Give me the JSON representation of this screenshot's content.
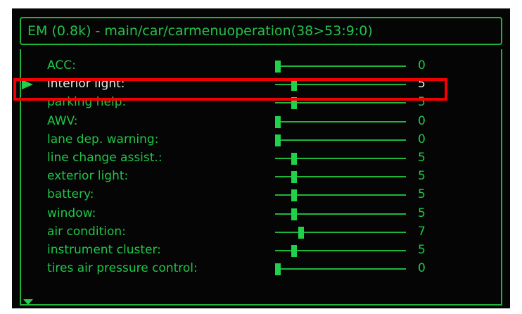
{
  "header": {
    "title": "EM (0.8k) - main/car/carmenuoperation(38>53:9:0)"
  },
  "menu": {
    "items": [
      {
        "label": "ACC:",
        "value": "0",
        "level": 0,
        "selected": false
      },
      {
        "label": "interior light:",
        "value": "5",
        "level": 5,
        "selected": true
      },
      {
        "label": "parking help:",
        "value": "5",
        "level": 5,
        "selected": false
      },
      {
        "label": "AWV:",
        "value": "0",
        "level": 0,
        "selected": false
      },
      {
        "label": "lane dep. warning:",
        "value": "0",
        "level": 0,
        "selected": false
      },
      {
        "label": "line change assist.:",
        "value": "5",
        "level": 5,
        "selected": false
      },
      {
        "label": "exterior light:",
        "value": "5",
        "level": 5,
        "selected": false
      },
      {
        "label": "battery:",
        "value": "5",
        "level": 5,
        "selected": false
      },
      {
        "label": "window:",
        "value": "5",
        "level": 5,
        "selected": false
      },
      {
        "label": "air condition:",
        "value": "7",
        "level": 7,
        "selected": false
      },
      {
        "label": "instrument cluster:",
        "value": "5",
        "level": 5,
        "selected": false
      },
      {
        "label": "tires air pressure control:",
        "value": "0",
        "level": 0,
        "selected": false
      }
    ],
    "slider_max": 40
  },
  "colors": {
    "background": "#050505",
    "accent_green": "#1fc649",
    "selected_text": "#e9e9e9",
    "highlight_red": "#f00000"
  },
  "icons": {
    "selection_pointer": "arrow-right-icon",
    "scroll_indicator": "arrow-down-icon"
  }
}
